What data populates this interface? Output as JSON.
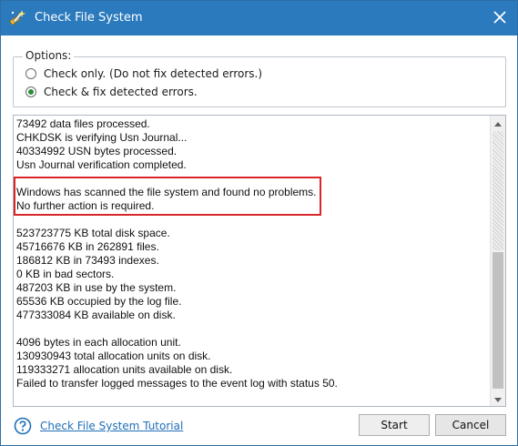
{
  "window": {
    "title": "Check File System"
  },
  "options": {
    "legend": "Options:",
    "radios": [
      {
        "label": "Check only. (Do not fix detected errors.)",
        "checked": false
      },
      {
        "label": "Check & fix detected errors.",
        "checked": true
      }
    ]
  },
  "log": {
    "lines": [
      "73492 data files processed.",
      "CHKDSK is verifying Usn Journal...",
      "40334992 USN bytes processed.",
      "Usn Journal verification completed.",
      "",
      "Windows has scanned the file system and found no problems.",
      "No further action is required.",
      "",
      "523723775 KB total disk space.",
      "45716676 KB in 262891 files.",
      "186812 KB in 73493 indexes.",
      "0 KB in bad sectors.",
      "487203 KB in use by the system.",
      "65536 KB occupied by the log file.",
      "477333084 KB available on disk.",
      "",
      "4096 bytes in each allocation unit.",
      "130930943 total allocation units on disk.",
      "119333271 allocation units available on disk.",
      "Failed to transfer logged messages to the event log with status 50."
    ],
    "highlight_color": "#d9262b"
  },
  "footer": {
    "tutorial_link": "Check File System Tutorial",
    "start_label": "Start",
    "cancel_label": "Cancel"
  },
  "colors": {
    "titlebar": "#2b7abd",
    "link": "#1e6fb8",
    "radio_checked": "#2e8b3a"
  },
  "icons": {
    "app": "wand-broom-icon",
    "close": "close-icon",
    "help": "help-circle-icon"
  }
}
